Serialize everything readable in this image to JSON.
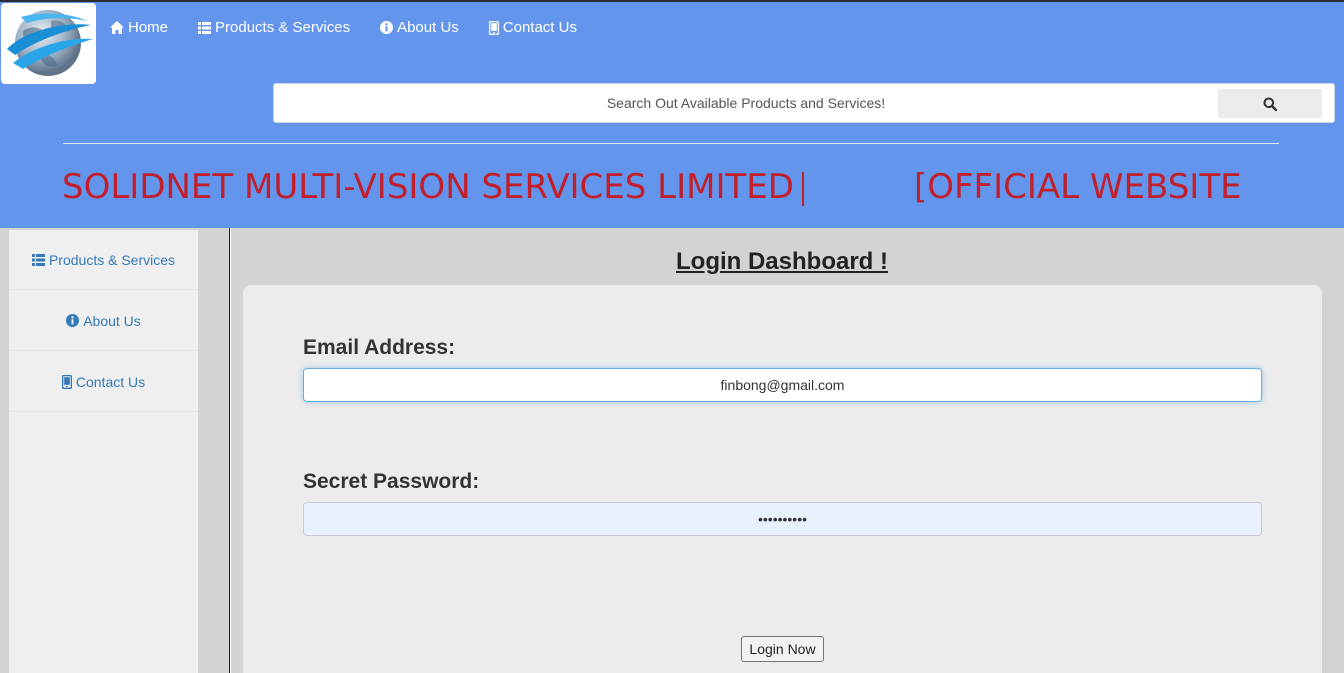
{
  "nav": {
    "items": [
      {
        "label": "Home",
        "icon": "home-icon"
      },
      {
        "label": "Products & Services",
        "icon": "list-icon"
      },
      {
        "label": "About Us",
        "icon": "info-circle-icon"
      },
      {
        "label": "Contact Us",
        "icon": "mobile-phone-icon"
      }
    ]
  },
  "search": {
    "placeholder": "Search Out Available Products and Services!",
    "button_icon": "search-icon"
  },
  "marquee": {
    "title": "SOLIDNET MULTI-VISION SERVICES LIMITED",
    "subtitle": "OFFICIAL WEBSITE"
  },
  "sidebar": {
    "items": [
      {
        "label": "Products & Services",
        "icon": "list-icon"
      },
      {
        "label": "About Us",
        "icon": "info-circle-icon"
      },
      {
        "label": "Contact Us",
        "icon": "mobile-phone-icon"
      }
    ]
  },
  "main": {
    "title": "Login Dashboard !",
    "email_label": "Email Address:",
    "email_value": "finbong@gmail.com",
    "password_label": "Secret Password:",
    "password_value": "••••••••••",
    "login_button": "Login Now"
  },
  "colors": {
    "header": "#6495ed",
    "marquee_text": "#c21f2a",
    "link": "#337ab7",
    "page_bg": "#d3d3d3",
    "panel_bg": "#ececec"
  }
}
